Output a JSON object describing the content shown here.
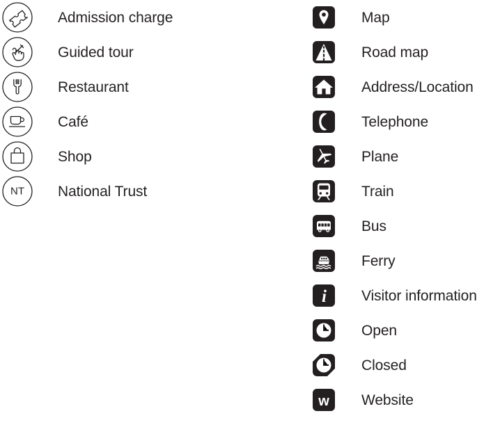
{
  "legend": {
    "style": {
      "ink": "#231f20",
      "background": "#ffffff",
      "left_icon_style": "outlined-circle",
      "right_icon_style": "filled-rounded-square"
    },
    "left_column": [
      {
        "icon": "ticket-icon",
        "label": "Admission charge"
      },
      {
        "icon": "pointing-hand-icon",
        "label": "Guided tour"
      },
      {
        "icon": "fork-icon",
        "label": "Restaurant"
      },
      {
        "icon": "coffee-cup-icon",
        "label": "Café"
      },
      {
        "icon": "shopping-bag-icon",
        "label": "Shop"
      },
      {
        "icon": "national-trust-icon",
        "label": "National Trust",
        "icon_text": "NT"
      }
    ],
    "right_column": [
      {
        "icon": "map-pin-icon",
        "label": "Map"
      },
      {
        "icon": "road-map-icon",
        "label": "Road map"
      },
      {
        "icon": "home-icon",
        "label": "Address/Location"
      },
      {
        "icon": "telephone-icon",
        "label": "Telephone"
      },
      {
        "icon": "plane-icon",
        "label": "Plane"
      },
      {
        "icon": "train-icon",
        "label": "Train"
      },
      {
        "icon": "bus-icon",
        "label": "Bus"
      },
      {
        "icon": "ferry-icon",
        "label": "Ferry"
      },
      {
        "icon": "info-icon",
        "label": "Visitor information",
        "icon_text": "i"
      },
      {
        "icon": "clock-open-icon",
        "label": "Open"
      },
      {
        "icon": "clock-closed-icon",
        "label": "Closed"
      },
      {
        "icon": "website-w-icon",
        "label": "Website",
        "icon_text": "w"
      }
    ]
  }
}
